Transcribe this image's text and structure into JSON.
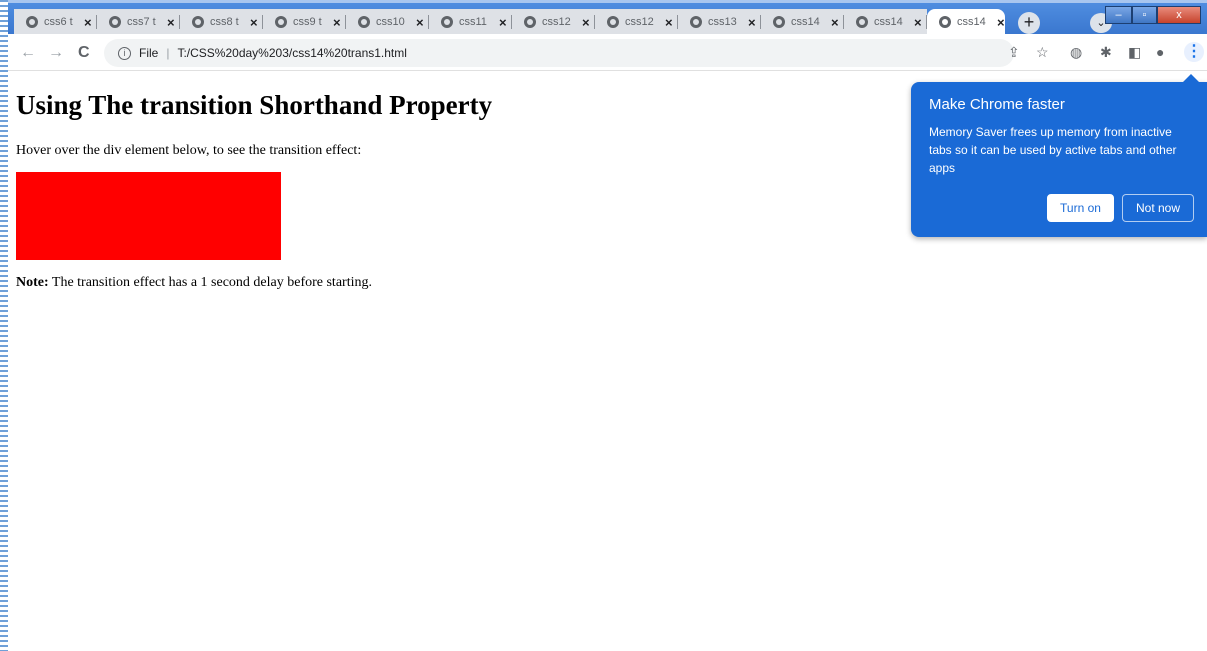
{
  "tabs": [
    {
      "title": "css6 t",
      "close": "×"
    },
    {
      "title": "css7 t",
      "close": "×"
    },
    {
      "title": "css8 t",
      "close": "×"
    },
    {
      "title": "css9 t",
      "close": "×"
    },
    {
      "title": "css10",
      "close": "×"
    },
    {
      "title": "css11",
      "close": "×"
    },
    {
      "title": "css12",
      "close": "×"
    },
    {
      "title": "css12",
      "close": "×"
    },
    {
      "title": "css13",
      "close": "×"
    },
    {
      "title": "css14",
      "close": "×"
    },
    {
      "title": "css14",
      "close": "×"
    },
    {
      "title": "css14",
      "close": "×"
    }
  ],
  "new_tab": "+",
  "tab_search": "⌄",
  "window_buttons": {
    "minimize": "–",
    "maximize": "▫",
    "close": "x"
  },
  "toolbar": {
    "back": "←",
    "forward": "→",
    "reload": "C",
    "scheme_label": "File",
    "url": "T:/CSS%20day%203/css14%20trans1.html"
  },
  "page": {
    "heading": "Using The transition Shorthand Property",
    "intro": "Hover over the div element below, to see the transition effect:",
    "note_label": "Note:",
    "note_text": " The transition effect has a 1 second delay before starting.",
    "box_color": "#ff0000"
  },
  "popup": {
    "title": "Make Chrome faster",
    "body": "Memory Saver frees up memory from inactive tabs so it can be used by active tabs and other apps",
    "turn_on": "Turn on",
    "not_now": "Not now",
    "color": "#1a6ad6"
  }
}
